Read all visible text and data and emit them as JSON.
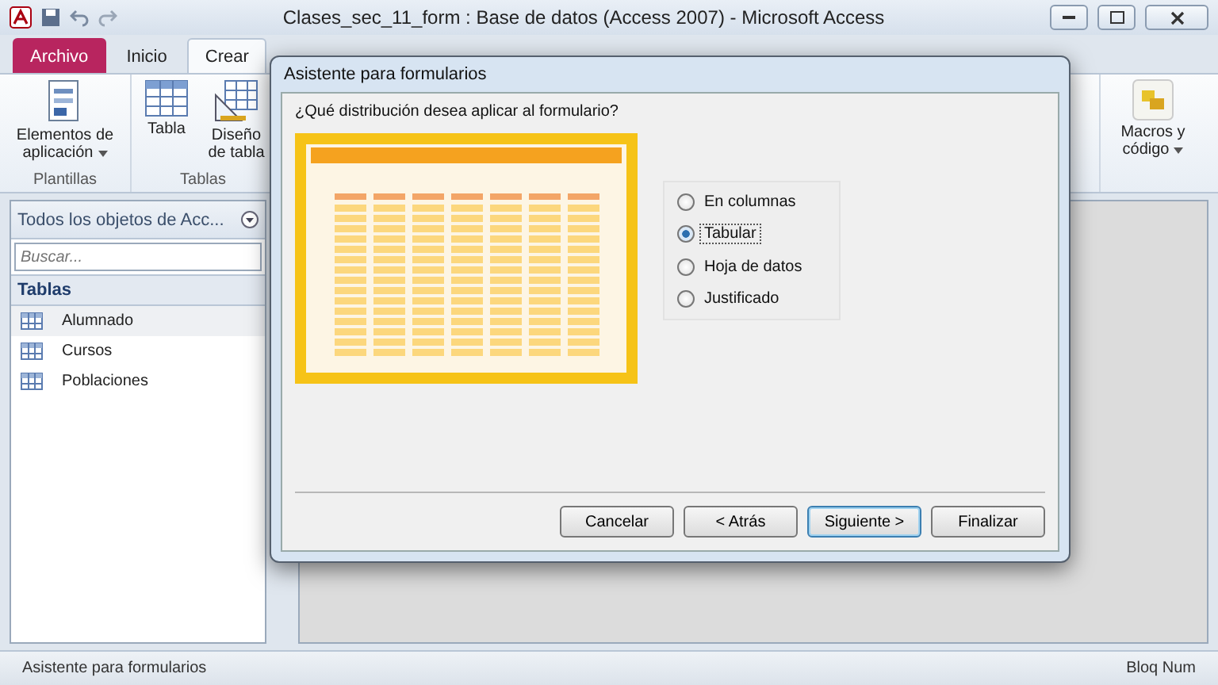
{
  "window": {
    "title": "Clases_sec_11_form : Base de datos (Access 2007)  -  Microsoft Access"
  },
  "ribbon_tabs": [
    {
      "label": "Archivo",
      "kind": "file",
      "selected": false
    },
    {
      "label": "Inicio",
      "kind": "tab",
      "selected": false
    },
    {
      "label": "Crear",
      "kind": "tab",
      "selected": true
    }
  ],
  "ribbon": {
    "left_groups": [
      {
        "label": "Plantillas",
        "commands": [
          {
            "label": "Elementos de aplicación",
            "kind": "app",
            "dropdown": true
          }
        ]
      },
      {
        "label": "Tablas",
        "commands": [
          {
            "label": "Tabla",
            "kind": "table",
            "dropdown": false
          },
          {
            "label": "Diseño de tabla",
            "kind": "design",
            "dropdown": false
          }
        ]
      }
    ],
    "right_command": {
      "label": "Macros y código",
      "dropdown": true
    }
  },
  "navigation": {
    "title": "Todos los objetos de Acc...",
    "search": {
      "placeholder": "Buscar..."
    },
    "section": "Tablas",
    "items": [
      {
        "label": "Alumnado",
        "selected": true
      },
      {
        "label": "Cursos",
        "selected": false
      },
      {
        "label": "Poblaciones",
        "selected": false
      }
    ]
  },
  "dialog": {
    "title": "Asistente para formularios",
    "question": "¿Qué distribución desea aplicar al formulario?",
    "options": [
      {
        "label": "En columnas",
        "selected": false
      },
      {
        "label": "Tabular",
        "selected": true
      },
      {
        "label": "Hoja de datos",
        "selected": false
      },
      {
        "label": "Justificado",
        "selected": false
      }
    ],
    "buttons": [
      {
        "label": "Cancelar",
        "default": false
      },
      {
        "label": "< Atrás",
        "default": false
      },
      {
        "label": "Siguiente >",
        "default": true
      },
      {
        "label": "Finalizar",
        "default": false
      }
    ]
  },
  "status_bar": {
    "left": "Asistente para formularios",
    "right": "Bloq Num"
  }
}
